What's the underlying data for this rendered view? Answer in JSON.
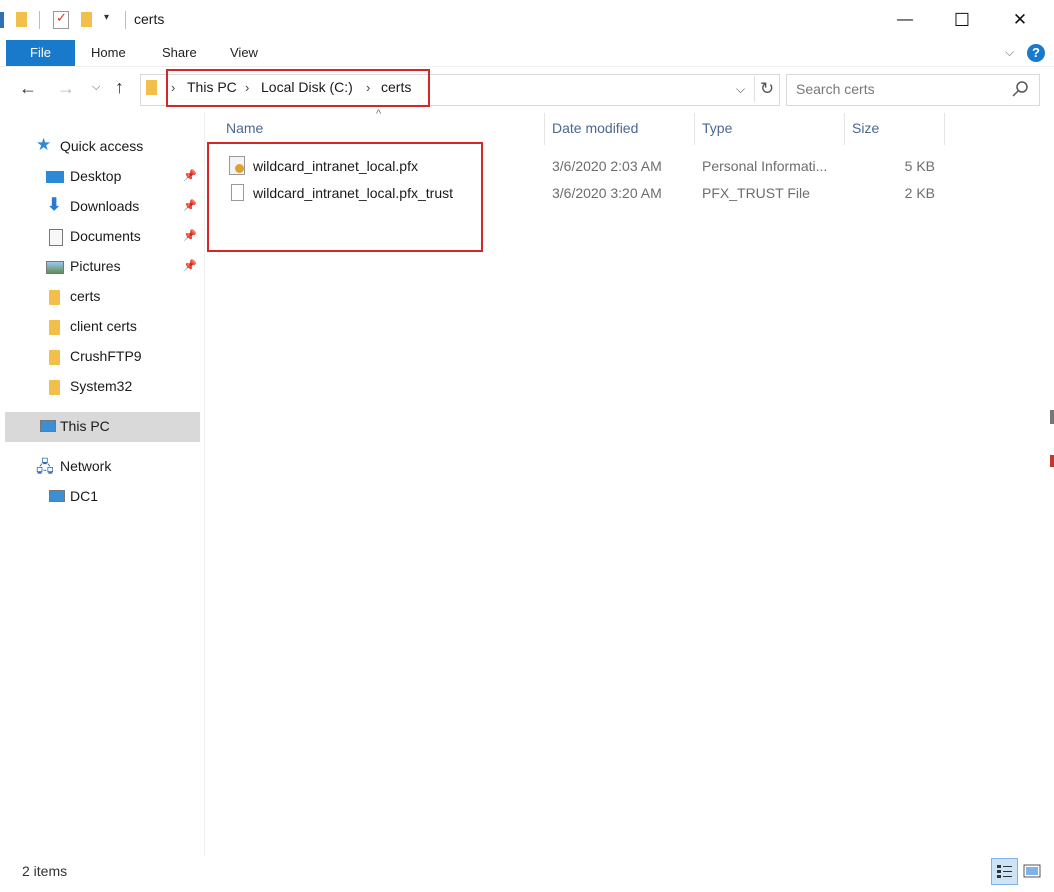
{
  "window": {
    "title": "certs",
    "minimize_glyph": "—",
    "maximize_glyph": "☐",
    "close_glyph": "✕"
  },
  "ribbon": {
    "tabs": [
      "File",
      "Home",
      "Share",
      "View"
    ],
    "help_glyph": "?"
  },
  "address": {
    "crumbs": [
      "This PC",
      "Local Disk (C:)",
      "certs"
    ],
    "search_placeholder": "Search certs"
  },
  "columns": {
    "name": "Name",
    "date": "Date modified",
    "type": "Type",
    "size": "Size"
  },
  "files": [
    {
      "name": "wildcard_intranet_local.pfx",
      "date": "3/6/2020 2:03 AM",
      "type": "Personal Informati...",
      "size": "5 KB",
      "icon": "certificate-file-icon"
    },
    {
      "name": "wildcard_intranet_local.pfx_trust",
      "date": "3/6/2020 3:20 AM",
      "type": "PFX_TRUST File",
      "size": "2 KB",
      "icon": "blank-file-icon"
    }
  ],
  "nav": {
    "quick_access": "Quick access",
    "pinned": [
      "Desktop",
      "Downloads",
      "Documents",
      "Pictures"
    ],
    "folders": [
      "certs",
      "client certs",
      "CrushFTP9",
      "System32"
    ],
    "this_pc": "This PC",
    "network": "Network",
    "dc1": "DC1"
  },
  "status": {
    "item_count": "2 items"
  },
  "colors": {
    "file_tab": "#1979ca",
    "highlight_box": "#d42828",
    "selected_nav": "#d9d9d9"
  }
}
